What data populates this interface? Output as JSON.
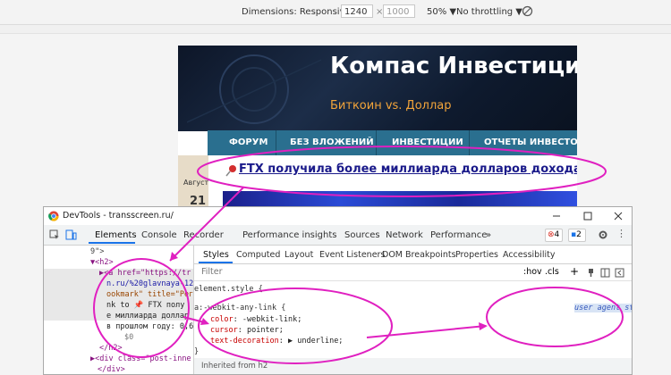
{
  "toolbar": {
    "dimensions_label": "Dimensions: Responsive ▼",
    "width_value": "1240",
    "times": "×",
    "height_placeholder": "1000",
    "zoom": "50% ▼",
    "throttling": "No throttling ▼"
  },
  "site": {
    "title": "Компас Инвестици",
    "subtitle": "Биткоин vs. Доллар",
    "nav": [
      "ФОРУМ",
      "БЕЗ ВЛОЖЕНИЙ",
      "ИНВЕСТИЦИИ",
      "ОТЧЕТЫ ИНВЕСТОРО"
    ],
    "date_month": "Август",
    "date_day": "21",
    "post_title": "FTX получила более миллиарда долларов дохода в про"
  },
  "devtools": {
    "window_title": "DevTools - transscreen.ru/",
    "tabs": [
      "Elements",
      "Console",
      "Recorder",
      "Performance insights",
      "Sources",
      "Network",
      "Performance",
      "»"
    ],
    "error_count": "4",
    "message_count": "2",
    "elements_lines": [
      "9\">",
      "▼<h2>",
      "▶<a href=\"https://tr",
      "n.ru/%20glavnaya-12",
      "ookmark\" title=\"Рег",
      "nk to 📌 FTX полу",
      "е миллиарда доллар",
      "в прошлом году: 0,6",
      "$0",
      "</h2>",
      "▶<div class=\"post-inne",
      "</div>"
    ],
    "style_tabs": [
      "Styles",
      "Computed",
      "Layout",
      "Event Listeners",
      "DOM Breakpoints",
      "Properties",
      "Accessibility"
    ],
    "filter_placeholder": "Filter",
    "hov": ":hov",
    "cls": ".cls",
    "element_style": "element.style {",
    "rule_selector": "a:-webkit-any-link {",
    "rule_source": "user agent stylesheet",
    "rule_props": [
      {
        "name": "color",
        "value": "-webkit-link;"
      },
      {
        "name": "cursor",
        "value": "pointer;"
      },
      {
        "name": "text-decoration",
        "value": "▶ underline;"
      }
    ],
    "rule_close": "}",
    "inherited": "Inherited from h2"
  },
  "colors": {
    "annotation": "#e020c0",
    "nav_bg": "#2a6f8f",
    "accent_orange": "#f2a43a",
    "devtools_blue": "#1a73e8"
  }
}
